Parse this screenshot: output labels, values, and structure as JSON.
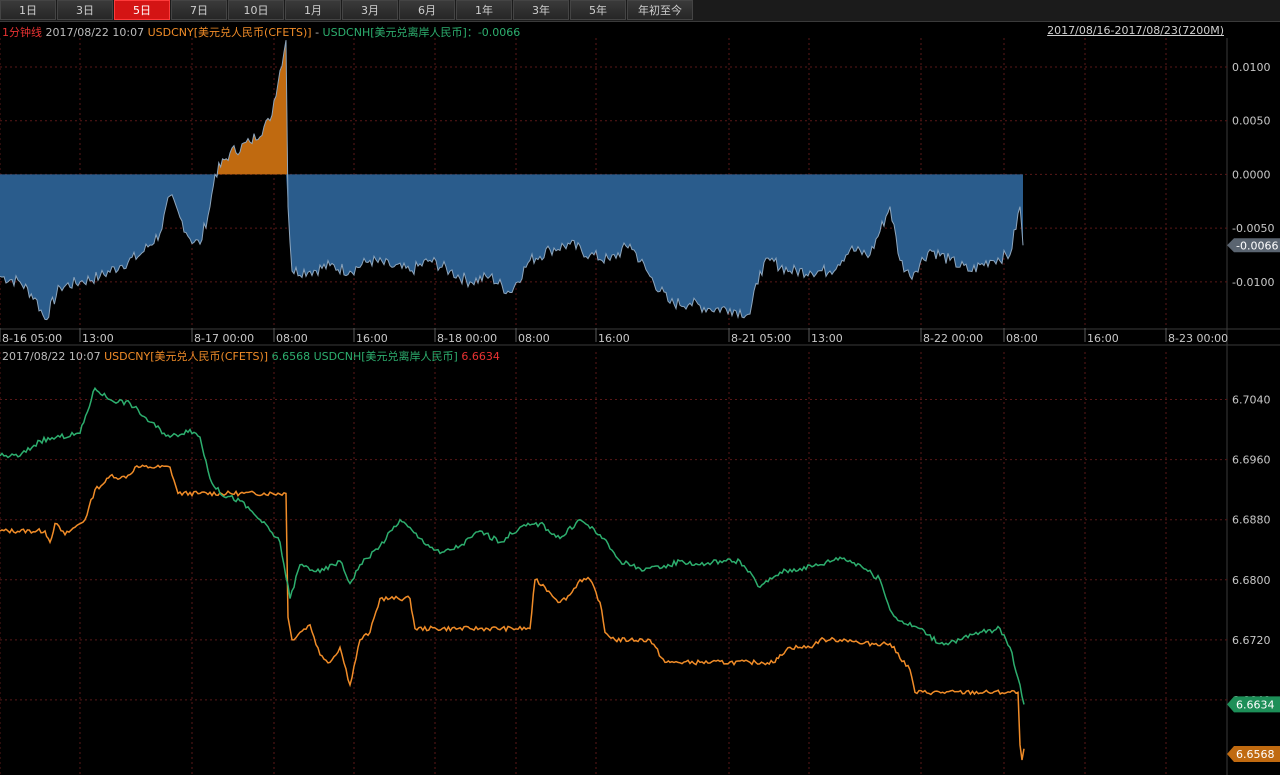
{
  "tabs": [
    "1日",
    "3日",
    "5日",
    "7日",
    "10日",
    "1月",
    "3月",
    "6月",
    "1年",
    "3年",
    "5年",
    "年初至今"
  ],
  "active_tab": "5日",
  "top_header": {
    "interval": "1分钟线",
    "datetime": "2017/08/22 10:07",
    "cny_label": "USDCNY[美元兑人民币(CFETS)]",
    "separator": " - ",
    "cnh_label": "USDCNH[美元兑离岸人民币]",
    "value_text": "：-0.0066",
    "range_link": "2017/08/16-2017/08/23(7200M)"
  },
  "bottom_header": {
    "datetime": "2017/08/22 10:07",
    "cny_label": "USDCNY[美元兑人民币(CFETS)]",
    "cny_value": "6.6568",
    "cnh_label": "USDCNH[美元兑离岸人民币]",
    "cnh_value": "6.6634"
  },
  "colors": {
    "cny": "#f08c28",
    "cnh": "#2dae6e",
    "spread_negative": "#2a5c8c",
    "spread_positive": "#c06a10",
    "grid": "#5a1818",
    "axis_text": "#c8c8c8"
  },
  "chart_data": [
    {
      "type": "area",
      "title": "USDCNY[美元兑人民币(CFETS)] - USDCNH[美元兑离岸人民币]",
      "ylim": [
        -0.0143,
        0.0127
      ],
      "y_ticks": [
        "0.0100",
        "0.0050",
        "0.0000",
        "-0.0050",
        "-0.0100"
      ],
      "y_tick_values": [
        0.01,
        0.005,
        0.0,
        -0.005,
        -0.01
      ],
      "current_label": "-0.0066",
      "current_value": -0.0066,
      "x_ticks": [
        "8-16 05:00",
        "13:00",
        "8-17 00:00",
        "08:00",
        "16:00",
        "8-18 00:00",
        "08:00",
        "16:00",
        "8-21 05:00",
        "13:00",
        "8-22 00:00",
        "08:00",
        "16:00",
        "8-23 00:00"
      ],
      "x_tick_positions": [
        0,
        80,
        192,
        274,
        354,
        435,
        516,
        596,
        729,
        809,
        921,
        1004,
        1085,
        1166
      ],
      "x_range": [
        0,
        1227
      ],
      "series": [
        {
          "x": [
            0,
            20,
            35,
            45,
            60,
            80,
            100,
            120,
            140,
            160,
            170,
            180,
            190,
            200,
            210,
            215,
            230,
            250,
            270,
            286,
            288,
            292,
            310,
            330,
            350,
            370,
            390,
            410,
            430,
            450,
            470,
            490,
            510,
            530,
            550,
            570,
            590,
            610,
            630,
            650,
            670,
            690,
            710,
            730,
            750,
            760,
            770,
            790,
            810,
            830,
            850,
            870,
            890,
            900,
            910,
            930,
            950,
            970,
            990,
            1010,
            1020,
            1023
          ],
          "values": [
            -0.0095,
            -0.01,
            -0.0115,
            -0.0135,
            -0.0105,
            -0.01,
            -0.0095,
            -0.0085,
            -0.0075,
            -0.0055,
            -0.002,
            -0.004,
            -0.006,
            -0.0065,
            -0.003,
            0.0,
            0.002,
            0.003,
            0.005,
            0.0125,
            -0.003,
            -0.009,
            -0.009,
            -0.0085,
            -0.009,
            -0.008,
            -0.0085,
            -0.009,
            -0.008,
            -0.009,
            -0.01,
            -0.0095,
            -0.011,
            -0.008,
            -0.007,
            -0.0065,
            -0.0075,
            -0.008,
            -0.0065,
            -0.0095,
            -0.012,
            -0.012,
            -0.0125,
            -0.0125,
            -0.013,
            -0.009,
            -0.008,
            -0.009,
            -0.009,
            -0.009,
            -0.007,
            -0.0075,
            -0.003,
            -0.008,
            -0.0095,
            -0.007,
            -0.008,
            -0.009,
            -0.008,
            -0.0075,
            -0.003,
            -0.0066
          ]
        }
      ]
    },
    {
      "type": "line",
      "title": "",
      "ylim": [
        6.654,
        6.709
      ],
      "y_ticks": [
        "6.7040",
        "6.6960",
        "6.6880",
        "6.6800",
        "6.6720",
        "6.6640"
      ],
      "y_tick_values": [
        6.704,
        6.696,
        6.688,
        6.68,
        6.672,
        6.664
      ],
      "x_range": [
        0,
        1227
      ],
      "series": [
        {
          "name": "USDCNY[美元兑人民币(CFETS)]",
          "color": "#f08c28",
          "x": [
            0,
            45,
            50,
            55,
            65,
            75,
            85,
            95,
            105,
            112,
            120,
            130,
            135,
            150,
            170,
            178,
            200,
            240,
            286,
            288,
            292,
            300,
            310,
            320,
            330,
            340,
            350,
            360,
            370,
            380,
            390,
            410,
            415,
            470,
            530,
            535,
            545,
            560,
            570,
            580,
            590,
            600,
            605,
            615,
            630,
            650,
            665,
            670,
            700,
            750,
            775,
            780,
            790,
            800,
            810,
            820,
            830,
            840,
            850,
            860,
            890,
            910,
            915,
            1018,
            1020,
            1022,
            1024
          ],
          "values": [
            6.6865,
            6.6865,
            6.685,
            6.6875,
            6.686,
            6.687,
            6.688,
            6.692,
            6.693,
            6.694,
            6.6935,
            6.694,
            6.695,
            6.695,
            6.695,
            6.6915,
            6.6915,
            6.6915,
            6.6915,
            6.675,
            6.672,
            6.673,
            6.674,
            6.67,
            6.669,
            6.671,
            6.666,
            6.672,
            6.673,
            6.6775,
            6.6775,
            6.6775,
            6.6735,
            6.6735,
            6.6735,
            6.68,
            6.679,
            6.677,
            6.678,
            6.68,
            6.68,
            6.677,
            6.673,
            6.672,
            6.672,
            6.672,
            6.669,
            6.669,
            6.669,
            6.669,
            6.669,
            6.67,
            6.671,
            6.671,
            6.671,
            6.672,
            6.672,
            6.672,
            6.672,
            6.6715,
            6.6715,
            6.668,
            6.665,
            6.665,
            6.658,
            6.656,
            6.6575
          ]
        },
        {
          "name": "USDCNH[美元兑离岸人民币]",
          "color": "#2dae6e",
          "x": [
            0,
            20,
            40,
            60,
            80,
            95,
            110,
            130,
            150,
            170,
            190,
            200,
            210,
            220,
            240,
            260,
            280,
            290,
            300,
            320,
            340,
            350,
            360,
            380,
            400,
            420,
            440,
            460,
            480,
            500,
            520,
            540,
            560,
            580,
            600,
            620,
            640,
            660,
            680,
            700,
            720,
            740,
            760,
            780,
            800,
            820,
            840,
            860,
            880,
            890,
            900,
            920,
            940,
            960,
            980,
            1000,
            1010,
            1020,
            1024
          ],
          "values": [
            6.6965,
            6.6965,
            6.6985,
            6.699,
            6.6995,
            6.7055,
            6.704,
            6.7035,
            6.701,
            6.699,
            6.7,
            6.699,
            6.6935,
            6.6915,
            6.6905,
            6.688,
            6.685,
            6.6775,
            6.682,
            6.681,
            6.6825,
            6.6795,
            6.682,
            6.6845,
            6.688,
            6.6855,
            6.6835,
            6.6845,
            6.6865,
            6.685,
            6.687,
            6.6875,
            6.6855,
            6.688,
            6.686,
            6.6825,
            6.6815,
            6.6815,
            6.6825,
            6.682,
            6.6825,
            6.6825,
            6.679,
            6.681,
            6.6815,
            6.682,
            6.683,
            6.682,
            6.68,
            6.676,
            6.6745,
            6.6735,
            6.6715,
            6.672,
            6.673,
            6.6735,
            6.671,
            6.666,
            6.6634
          ]
        }
      ],
      "current_labels": [
        {
          "text": "6.6634",
          "value": 6.6634,
          "color": "#1d8f58"
        },
        {
          "text": "6.6568",
          "value": 6.6568,
          "color": "#c06a10"
        }
      ]
    }
  ]
}
